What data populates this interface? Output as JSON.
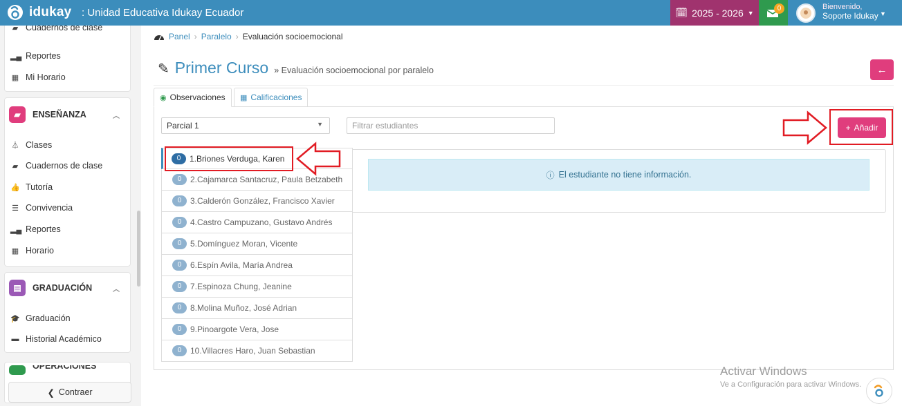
{
  "header": {
    "brand": "idukay",
    "org": ": Unidad Educativa Idukay Ecuador",
    "year": "2025 - 2026",
    "msg_count": "0",
    "welcome_line1": "Bienvenido,",
    "welcome_line2": "Soporte Idukay",
    "colors": {
      "bar": "#3c8dbc",
      "year_bg": "#a0336e",
      "msg_bg": "#2f9a4e"
    }
  },
  "sidebar": {
    "top_items": [
      {
        "label": "Cuadernos de clase",
        "icon": "notebook-icon"
      },
      {
        "label": "Reportes",
        "icon": "bar-chart-icon"
      },
      {
        "label": "Mi Horario",
        "icon": "calendar-icon"
      }
    ],
    "sections": [
      {
        "title": "ENSEÑANZA",
        "color": "#e03d7d",
        "items": [
          {
            "label": "Clases",
            "icon": "flask-icon"
          },
          {
            "label": "Cuadernos de clase",
            "icon": "notebook-icon"
          },
          {
            "label": "Tutoría",
            "icon": "thumbs-up-icon"
          },
          {
            "label": "Convivencia",
            "icon": "list-icon"
          },
          {
            "label": "Reportes",
            "icon": "bar-chart-icon"
          },
          {
            "label": "Horario",
            "icon": "calendar-icon"
          }
        ]
      },
      {
        "title": "GRADUACIÓN",
        "color": "#9b59b6",
        "items": [
          {
            "label": "Graduación",
            "icon": "graduation-cap-icon"
          },
          {
            "label": "Historial Académico",
            "icon": "folder-open-icon"
          }
        ]
      },
      {
        "title": "OPERACIONES",
        "color": "#2f9a4e",
        "items": []
      }
    ],
    "collapse_label": "Contraer"
  },
  "breadcrumb": [
    "Panel",
    "Paralelo",
    "Evaluación socioemocional"
  ],
  "page": {
    "title": "Primer Curso",
    "subtitle": "» Evaluación socioemocional por paralelo"
  },
  "tabs": [
    {
      "label": "Observaciones",
      "icon": "eye-icon",
      "active": true
    },
    {
      "label": "Calificaciones",
      "icon": "table-icon",
      "active": false
    }
  ],
  "filters": {
    "period_value": "Parcial 1",
    "search_placeholder": "Filtrar estudiantes"
  },
  "add_label": "Añadir",
  "info_message": "El estudiante no tiene información.",
  "students": [
    {
      "count": "0",
      "name": "1.Briones Verduga, Karen",
      "active": true
    },
    {
      "count": "0",
      "name": "2.Cajamarca Santacruz, Paula Betzabeth",
      "active": false
    },
    {
      "count": "0",
      "name": "3.Calderón González, Francisco Xavier",
      "active": false
    },
    {
      "count": "0",
      "name": "4.Castro Campuzano, Gustavo Andrés",
      "active": false
    },
    {
      "count": "0",
      "name": "5.Domínguez Moran, Vicente",
      "active": false
    },
    {
      "count": "0",
      "name": "6.Espín Avila, María Andrea",
      "active": false
    },
    {
      "count": "0",
      "name": "7.Espinoza Chung, Jeanine",
      "active": false
    },
    {
      "count": "0",
      "name": "8.Molina Muñoz, José Adrian",
      "active": false
    },
    {
      "count": "0",
      "name": "9.Pinoargote Vera, Jose",
      "active": false
    },
    {
      "count": "0",
      "name": "10.Villacres Haro, Juan Sebastian",
      "active": false
    }
  ],
  "watermark": {
    "line1": "Activar Windows",
    "line2": "Ve a Configuración para activar Windows."
  },
  "accent_color": "#e03d7d",
  "highlight_color": "#e11b23"
}
